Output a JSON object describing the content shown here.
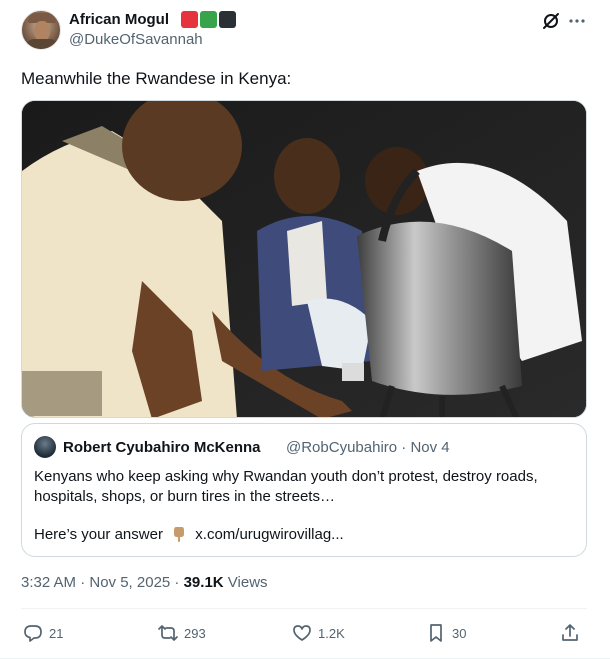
{
  "author": {
    "display_name": "African Mogul",
    "handle": "@DukeOfSavannah",
    "flag_colors": [
      "#e5343d",
      "#37a34a",
      "#2b2f36"
    ]
  },
  "tweet": {
    "text": "Meanwhile the Rwandese in Kenya:"
  },
  "quoted": {
    "display_name": "Robert Cyubahiro McKenna",
    "handle_time": "@RobCyubahiro · Nov 4",
    "lines": [
      "Kenyans who keep asking why Rwandan youth don’t protest, destroy roads,",
      "hospitals, shops, or burn tires in the streets…"
    ],
    "answer_label": "Here’s your answer",
    "link": "x.com/urugwirovillag..."
  },
  "meta": {
    "timestamp": "3:32 AM · Nov 5, 2025 · ",
    "views_count": "39.1K",
    "views_label": " Views"
  },
  "actions": {
    "replies": "21",
    "reposts": "293",
    "likes": "1.2K",
    "bookmarks": "30"
  },
  "icons": [
    "grok-icon",
    "more-icon",
    "reply-icon",
    "retweet-icon",
    "like-icon",
    "bookmark-icon",
    "share-icon",
    "backhand-index-pointing-down-icon"
  ]
}
